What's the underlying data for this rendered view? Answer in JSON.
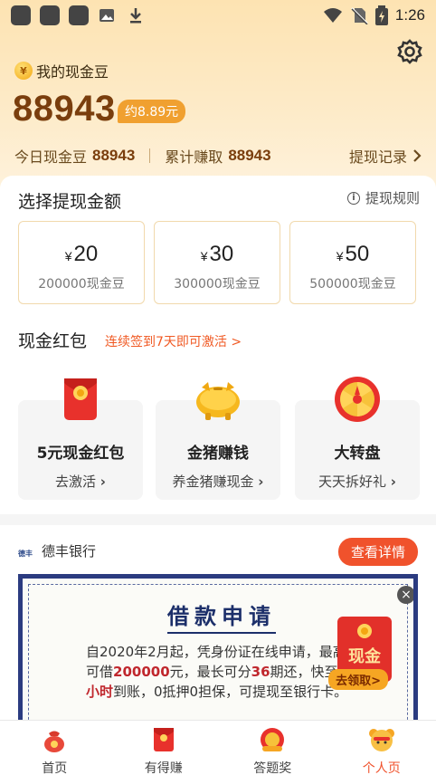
{
  "status_bar": {
    "time": "1:26"
  },
  "header": {
    "coin_symbol": "¥",
    "title": "我的现金豆",
    "balance": "88943",
    "approx_value": "约8.89元",
    "today_label": "今日现金豆",
    "today_value": "88943",
    "total_label": "累计赚取",
    "total_value": "88943",
    "record_label": "提现记录"
  },
  "withdraw": {
    "title": "选择提现金额",
    "rule_label": "提现规则",
    "currency": "¥",
    "options": [
      {
        "amount": "20",
        "beans": "200000现金豆"
      },
      {
        "amount": "30",
        "beans": "300000现金豆"
      },
      {
        "amount": "50",
        "beans": "500000现金豆"
      }
    ]
  },
  "red_packet": {
    "title": "现金红包",
    "hint": "连续签到7天即可激活 >",
    "features": [
      {
        "title": "5元现金红包",
        "sub": "去激活"
      },
      {
        "title": "金猪赚钱",
        "sub": "养金猪赚现金"
      },
      {
        "title": "大转盘",
        "sub": "天天拆好礼"
      }
    ]
  },
  "ad": {
    "bank_logo": "德丰",
    "bank_name": "德丰银行",
    "detail_button": "查看详情",
    "loan_title": "借款申请",
    "loan_text_1": "自2020年2月起，凭身份证在线申请，最高可借",
    "loan_amount": "200000",
    "loan_text_2": "元，最长可分",
    "loan_period": "36",
    "loan_text_3": "期还，快至",
    "loan_time": "1小时",
    "loan_text_4": "到账，0抵押0担保，可提现至银行卡。",
    "badge_text": "现金",
    "badge_go": "去领取>"
  },
  "nav": {
    "items": [
      {
        "label": "首页"
      },
      {
        "label": "有得赚"
      },
      {
        "label": "答题奖"
      },
      {
        "label": "个人页"
      }
    ]
  },
  "colors": {
    "accent": "#f0522c",
    "gold": "#7a3e0d",
    "navy": "#2b3b80"
  }
}
